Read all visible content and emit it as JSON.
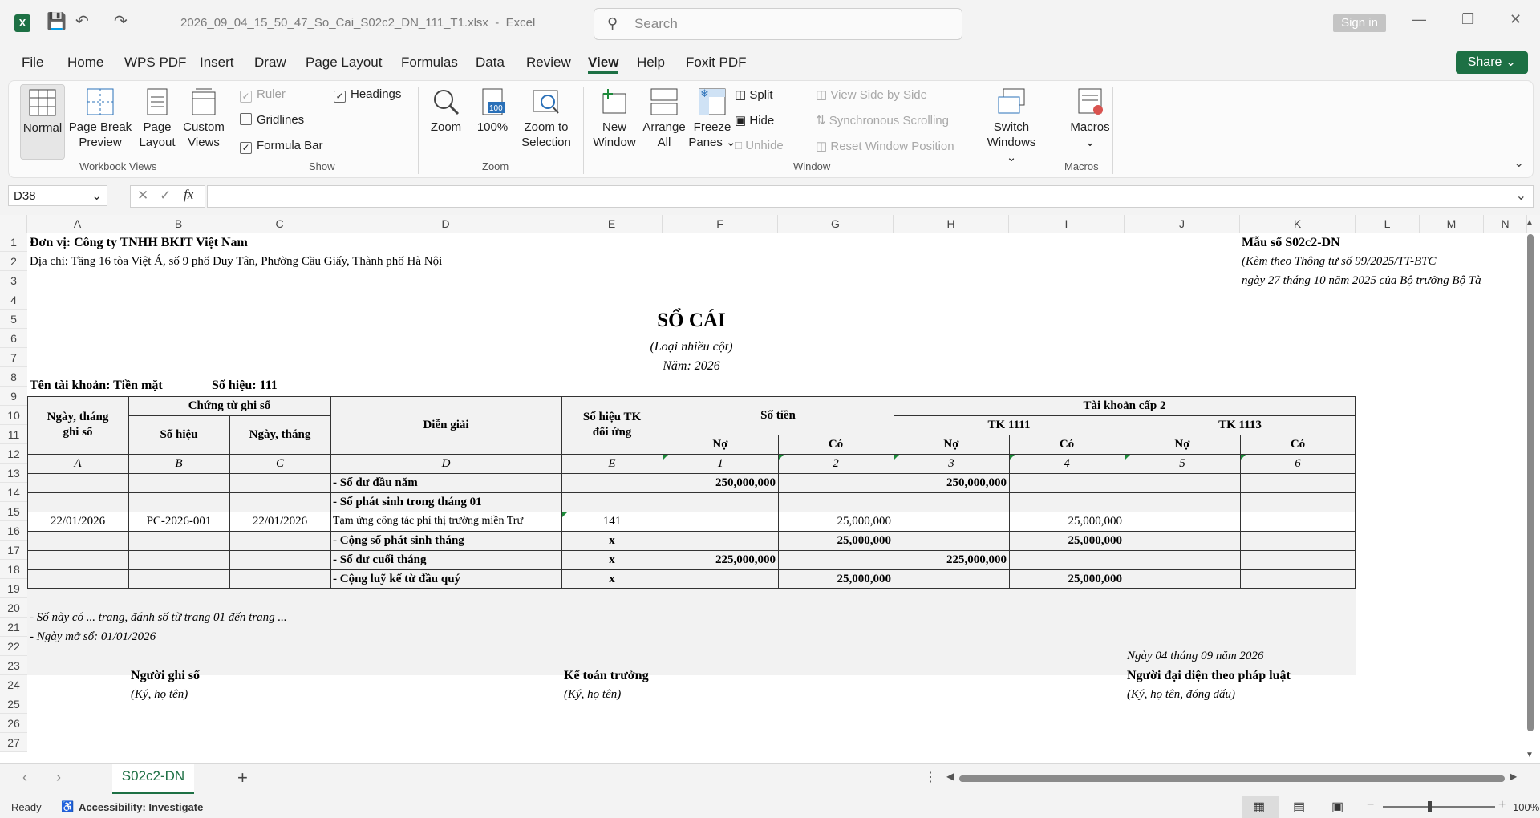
{
  "titlebar": {
    "filename": "2026_09_04_15_50_47_So_Cai_S02c2_DN_111_T1.xlsx",
    "app": "Excel",
    "search_placeholder": "Search",
    "signin": "Sign in"
  },
  "tabs": [
    "File",
    "Home",
    "WPS PDF",
    "Insert",
    "Draw",
    "Page Layout",
    "Formulas",
    "Data",
    "Review",
    "View",
    "Help",
    "Foxit PDF"
  ],
  "share_label": "Share",
  "ribbon": {
    "workbook_views": {
      "normal": "Normal",
      "page_break": "Page Break",
      "page_break2": "Preview",
      "page_layout": "Page",
      "page_layout2": "Layout",
      "custom": "Custom",
      "custom2": "Views",
      "label": "Workbook Views"
    },
    "show": {
      "ruler": "Ruler",
      "gridlines": "Gridlines",
      "formula_bar": "Formula Bar",
      "headings": "Headings",
      "label": "Show"
    },
    "zoom": {
      "zoom": "Zoom",
      "hundred": "100%",
      "zoom_sel": "Zoom to",
      "zoom_sel2": "Selection",
      "label": "Zoom"
    },
    "window": {
      "new_window": "New",
      "new_window2": "Window",
      "arrange": "Arrange",
      "arrange2": "All",
      "freeze": "Freeze",
      "freeze2": "Panes",
      "split": "Split",
      "hide": "Hide",
      "unhide": "Unhide",
      "side_by_side": "View Side by Side",
      "sync_scroll": "Synchronous Scrolling",
      "reset_pos": "Reset Window Position",
      "switch": "Switch",
      "switch2": "Windows",
      "label": "Window"
    },
    "macros": {
      "macros": "Macros",
      "label": "Macros"
    }
  },
  "namebox": "D38",
  "fx": "fx",
  "columns": [
    "A",
    "B",
    "C",
    "D",
    "E",
    "F",
    "G",
    "H",
    "I",
    "J",
    "K",
    "L",
    "M",
    "N"
  ],
  "rows": [
    "1",
    "2",
    "3",
    "4",
    "5",
    "6",
    "7",
    "8",
    "9",
    "10",
    "11",
    "12",
    "13",
    "14",
    "15",
    "16",
    "17",
    "18",
    "19",
    "20",
    "21",
    "22",
    "23",
    "24",
    "25",
    "26",
    "27"
  ],
  "sheet": {
    "unit": "Đơn vị: Công ty TNHH BKIT Việt Nam",
    "address": "Địa chỉ: Tầng 16 tòa Việt Á, số 9 phố Duy Tân, Phường Cầu Giấy, Thành phố Hà Nội",
    "form_no": "Mẫu số S02c2-DN",
    "form_ref": "(Kèm theo Thông tư số 99/2025/TT-BTC",
    "form_date": "ngày 27 tháng 10 năm 2025 của Bộ trưởng Bộ Tà",
    "title": "SỔ CÁI",
    "subtitle": "(Loại nhiều cột)",
    "year": "Năm: 2026",
    "account_name": "Tên tài khoản: Tiền mặt",
    "account_no": "Số hiệu: 111",
    "hdr": {
      "date": "Ngày, tháng",
      "date2": "ghi sổ",
      "voucher": "Chứng từ ghi sổ",
      "voucher_no": "Số hiệu",
      "voucher_date": "Ngày, tháng",
      "desc": "Diễn giải",
      "contra": "Số hiệu TK",
      "contra2": "đối ứng",
      "amount": "Số tiền",
      "sub_accounts": "Tài khoản cấp 2",
      "tk1111": "TK 1111",
      "tk1113": "TK 1113",
      "debit": "Nợ",
      "credit": "Có"
    },
    "codes": [
      "A",
      "B",
      "C",
      "D",
      "E",
      "1",
      "2",
      "3",
      "4",
      "5",
      "6"
    ],
    "rows": [
      {
        "a": "",
        "b": "",
        "c": "",
        "d": "- Số dư đầu năm",
        "e": "",
        "f": "250,000,000",
        "g": "",
        "h": "250,000,000",
        "i": "",
        "j": "",
        "k": "",
        "bold": true
      },
      {
        "a": "",
        "b": "",
        "c": "",
        "d": "- Số phát sinh trong tháng 01",
        "e": "",
        "f": "",
        "g": "",
        "h": "",
        "i": "",
        "j": "",
        "k": "",
        "bold": true
      },
      {
        "a": "22/01/2026",
        "b": "PC-2026-001",
        "c": "22/01/2026",
        "d": "Tạm ứng công tác phí thị trường miền Trư",
        "e": "141",
        "f": "",
        "g": "25,000,000",
        "h": "",
        "i": "25,000,000",
        "j": "",
        "k": "",
        "bold": false
      },
      {
        "a": "",
        "b": "",
        "c": "",
        "d": "- Cộng số phát sinh tháng",
        "e": "x",
        "f": "",
        "g": "25,000,000",
        "h": "",
        "i": "25,000,000",
        "j": "",
        "k": "",
        "bold": true
      },
      {
        "a": "",
        "b": "",
        "c": "",
        "d": "- Số dư cuối tháng",
        "e": "x",
        "f": "225,000,000",
        "g": "",
        "h": "225,000,000",
        "i": "",
        "j": "",
        "k": "",
        "bold": true
      },
      {
        "a": "",
        "b": "",
        "c": "",
        "d": "- Cộng luỹ kế từ đầu quý",
        "e": "x",
        "f": "",
        "g": "25,000,000",
        "h": "",
        "i": "25,000,000",
        "j": "",
        "k": "",
        "bold": true
      }
    ],
    "note1": "- Sổ này có ... trang, đánh số từ trang 01 đến trang ...",
    "note2": "- Ngày mở sổ: 01/01/2026",
    "sign_date": "Ngày 04 tháng 09 năm 2026",
    "signer1": "Người ghi sổ",
    "signer1_note": "(Ký, họ tên)",
    "signer2": "Kế toán trưởng",
    "signer2_note": "(Ký, họ tên)",
    "signer3": "Người đại diện theo pháp luật",
    "signer3_note": "(Ký, họ tên, đóng dấu)"
  },
  "sheet_tab": "S02c2-DN",
  "status": {
    "ready": "Ready",
    "accessibility": "Accessibility: Investigate",
    "zoom": "100%"
  }
}
